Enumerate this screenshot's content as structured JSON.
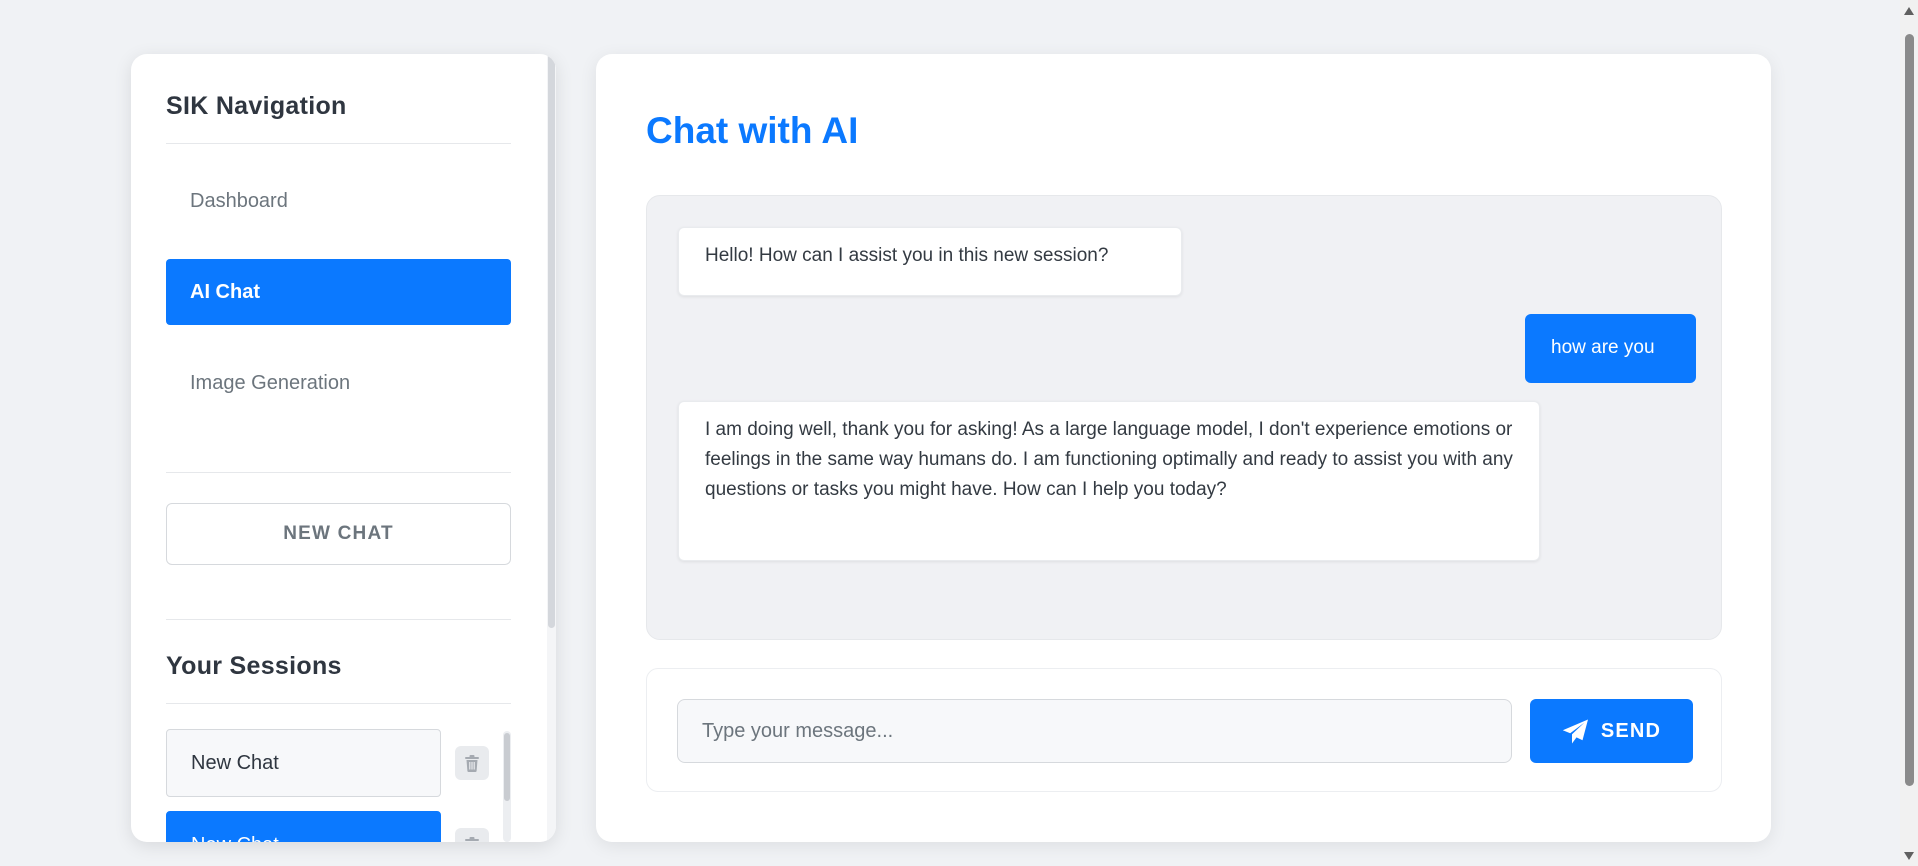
{
  "sidebar": {
    "title": "SIK Navigation",
    "nav_items": [
      {
        "label": "Dashboard",
        "active": false
      },
      {
        "label": "AI Chat",
        "active": true
      },
      {
        "label": "Image Generation",
        "active": false
      }
    ],
    "new_chat_label": "NEW CHAT",
    "sessions_title": "Your Sessions",
    "sessions": [
      {
        "label": "New Chat",
        "active": false,
        "delete_icon": "trash-icon"
      },
      {
        "label": "New Chat",
        "active": true,
        "delete_icon": "trash-icon"
      }
    ]
  },
  "main": {
    "title": "Chat with AI",
    "messages": [
      {
        "role": "ai",
        "text": "Hello! How can I assist you in this new session?"
      },
      {
        "role": "user",
        "text": "how are you"
      },
      {
        "role": "ai",
        "text": "I am doing well, thank you for asking! As a large language model, I don't experience emotions or feelings in the same way humans do. I am functioning optimally and ready to assist you with any questions or tasks you might have. How can I help you today?"
      }
    ],
    "input": {
      "placeholder": "Type your message...",
      "value": ""
    },
    "send": {
      "label": "SEND",
      "icon": "paper-plane-icon"
    }
  },
  "colors": {
    "accent": "#0b79ff",
    "background": "#f0f2f5",
    "panel": "#ffffff",
    "chat_area": "#f0f1f4"
  }
}
